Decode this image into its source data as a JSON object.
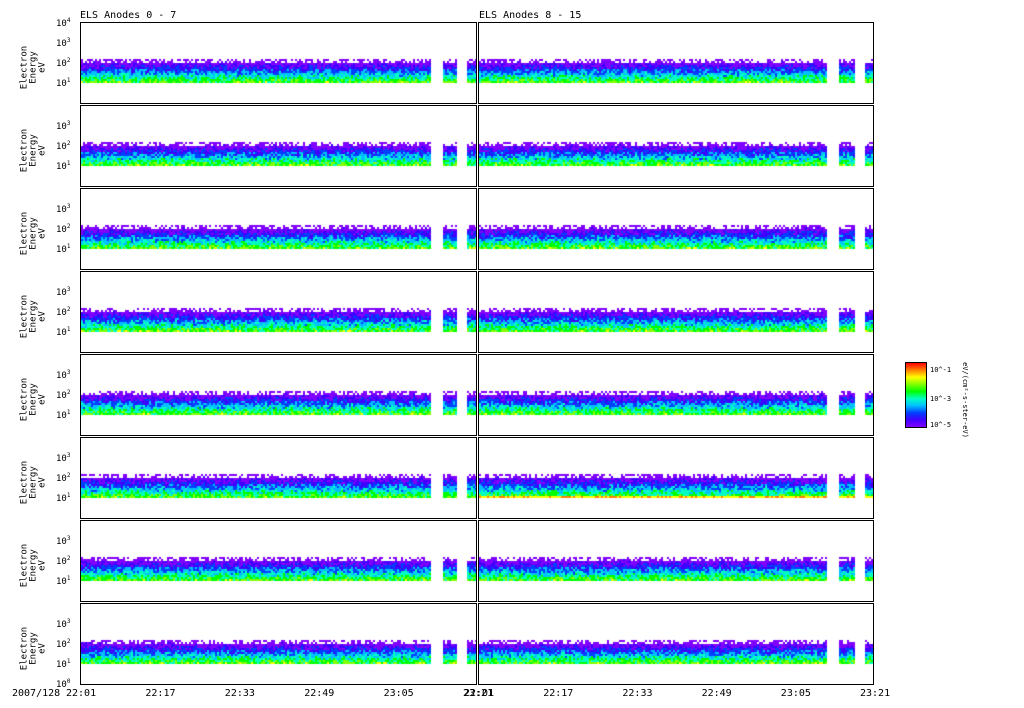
{
  "chart_data": {
    "type": "heatmap",
    "titles": [
      "ELS Anodes 0 - 7",
      "ELS Anodes 8 - 15"
    ],
    "ylabel": "Electron Energy",
    "yunits": "eV",
    "yticks": [
      "10^0",
      "10^1",
      "10^2",
      "10^3",
      "10^4"
    ],
    "ylim_log10": [
      0,
      4
    ],
    "date_label": "2007/128",
    "xticks": [
      "22:01",
      "22:17",
      "22:33",
      "22:49",
      "23:05",
      "23:21"
    ],
    "rows_per_column": 8,
    "energy_band_log10": [
      1,
      2
    ],
    "data_gaps": [
      [
        "23:12",
        "23:14"
      ],
      [
        "23:17",
        "23:19"
      ]
    ],
    "colorbar": {
      "label": "eV/(cm²-s-ster-eV)",
      "ticks": [
        "10^-1",
        "10^-3",
        "10^-5"
      ],
      "colors": [
        "#ff0000",
        "#ff8000",
        "#ffff00",
        "#80ff00",
        "#00ff00",
        "#00ffc0",
        "#00c0ff",
        "#0040ff",
        "#4000ff",
        "#8000ff"
      ]
    }
  }
}
